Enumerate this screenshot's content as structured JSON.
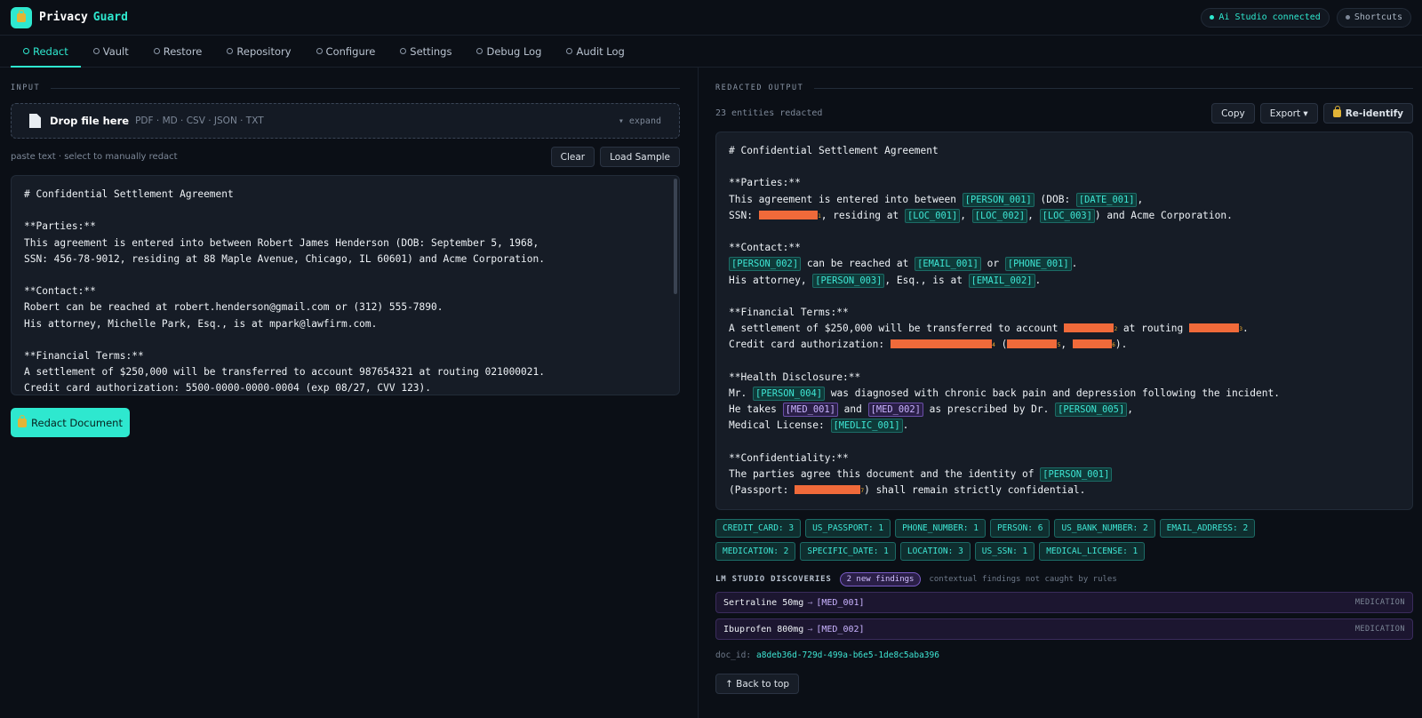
{
  "app": {
    "name": "Privacy",
    "name_accent": "Guard"
  },
  "header": {
    "status_label": "Ai Studio connected",
    "status_color": "#2ee8cf",
    "shortcuts_label": "Shortcuts"
  },
  "tabs": [
    {
      "label": "Redact",
      "active": true
    },
    {
      "label": "Vault"
    },
    {
      "label": "Restore"
    },
    {
      "label": "Repository"
    },
    {
      "label": "Configure"
    },
    {
      "label": "Settings"
    },
    {
      "label": "Debug Log"
    },
    {
      "label": "Audit Log"
    }
  ],
  "input": {
    "section_label": "INPUT",
    "drop_title": "Drop file here",
    "drop_types": "PDF · MD · CSV · JSON · TXT",
    "expand_label": "▾ expand",
    "hint": "paste text · select to manually redact",
    "clear_label": "Clear",
    "load_sample_label": "Load Sample",
    "text": "# Confidential Settlement Agreement\n\n**Parties:**\nThis agreement is entered into between Robert James Henderson (DOB: September 5, 1968,\nSSN: 456-78-9012, residing at 88 Maple Avenue, Chicago, IL 60601) and Acme Corporation.\n\n**Contact:**\nRobert can be reached at robert.henderson@gmail.com or (312) 555-7890.\nHis attorney, Michelle Park, Esq., is at mpark@lawfirm.com.\n\n**Financial Terms:**\nA settlement of $250,000 will be transferred to account 987654321 at routing 021000021.\nCredit card authorization: 5500-0000-0000-0004 (exp 08/27, CVV 123).",
    "redact_button": "Redact Document"
  },
  "output": {
    "section_label": "REDACTED OUTPUT",
    "count_label": "23 entities redacted",
    "copy_label": "Copy",
    "export_label": "Export ▾",
    "reidentify_label": "Re-identify",
    "lines": [
      [
        {
          "t": "# Confidential Settlement Agreement"
        }
      ],
      [],
      [
        {
          "t": "**Parties:**"
        }
      ],
      [
        {
          "t": "This agreement is entered into between "
        },
        {
          "k": "[PERSON_001]"
        },
        {
          "t": " (DOB: "
        },
        {
          "k": "[DATE_001]"
        },
        {
          "t": ","
        }
      ],
      [
        {
          "t": "SSN: "
        },
        {
          "r": 66,
          "n": "1"
        },
        {
          "t": ", residing at "
        },
        {
          "k": "[LOC_001]"
        },
        {
          "t": ", "
        },
        {
          "k": "[LOC_002]"
        },
        {
          "t": ", "
        },
        {
          "k": "[LOC_003]"
        },
        {
          "t": ") and Acme Corporation."
        }
      ],
      [],
      [
        {
          "t": "**Contact:**"
        }
      ],
      [
        {
          "k": "[PERSON_002]"
        },
        {
          "t": " can be reached at "
        },
        {
          "k": "[EMAIL_001]"
        },
        {
          "t": " or "
        },
        {
          "k": "[PHONE_001]"
        },
        {
          "t": "."
        }
      ],
      [
        {
          "t": "His attorney, "
        },
        {
          "k": "[PERSON_003]"
        },
        {
          "t": ", Esq., is at "
        },
        {
          "k": "[EMAIL_002]"
        },
        {
          "t": "."
        }
      ],
      [],
      [
        {
          "t": "**Financial Terms:**"
        }
      ],
      [
        {
          "t": "A settlement of $250,000 will be transferred to account "
        },
        {
          "r": 56,
          "n": "2"
        },
        {
          "t": " at routing "
        },
        {
          "r": 56,
          "n": "3"
        },
        {
          "t": "."
        }
      ],
      [
        {
          "t": "Credit card authorization: "
        },
        {
          "r": 114,
          "n": "4"
        },
        {
          "t": " ("
        },
        {
          "r": 56,
          "n": "5"
        },
        {
          "t": ", "
        },
        {
          "r": 44,
          "n": "6"
        },
        {
          "t": ")."
        }
      ],
      [],
      [
        {
          "t": "**Health Disclosure:**"
        }
      ],
      [
        {
          "t": "Mr. "
        },
        {
          "k": "[PERSON_004]"
        },
        {
          "t": " was diagnosed with chronic back pain and depression following the incident."
        }
      ],
      [
        {
          "t": "He takes "
        },
        {
          "k": "[MED_001]",
          "m": true
        },
        {
          "t": " and "
        },
        {
          "k": "[MED_002]",
          "m": true
        },
        {
          "t": " as prescribed by Dr. "
        },
        {
          "k": "[PERSON_005]"
        },
        {
          "t": ","
        }
      ],
      [
        {
          "t": "Medical License: "
        },
        {
          "k": "[MEDLIC_001]"
        },
        {
          "t": "."
        }
      ],
      [],
      [
        {
          "t": "**Confidentiality:**"
        }
      ],
      [
        {
          "t": "The parties agree this document and the identity of "
        },
        {
          "k": "[PERSON_001]"
        }
      ],
      [
        {
          "t": "(Passport: "
        },
        {
          "r": 74,
          "n": "7"
        },
        {
          "t": ") shall remain strictly confidential."
        }
      ]
    ]
  },
  "entity_chips": [
    "CREDIT_CARD: 3",
    "US_PASSPORT: 1",
    "PHONE_NUMBER: 1",
    "PERSON: 6",
    "US_BANK_NUMBER: 2",
    "EMAIL_ADDRESS: 2",
    "MEDICATION: 2",
    "SPECIFIC_DATE: 1",
    "LOCATION: 3",
    "US_SSN: 1",
    "MEDICAL_LICENSE: 1"
  ],
  "discoveries": {
    "title": "LM STUDIO DISCOVERIES",
    "badge": "2 new findings",
    "note": "contextual findings not caught by rules",
    "items": [
      {
        "name": "Sertraline 50mg",
        "token": "[MED_001]",
        "type": "MEDICATION"
      },
      {
        "name": "Ibuprofen 800mg",
        "token": "[MED_002]",
        "type": "MEDICATION"
      }
    ]
  },
  "doc": {
    "label": "doc_id:",
    "id": "a8deb36d-729d-499a-b6e5-1de8c5aba396"
  },
  "back_to_top": "↑ Back to top"
}
